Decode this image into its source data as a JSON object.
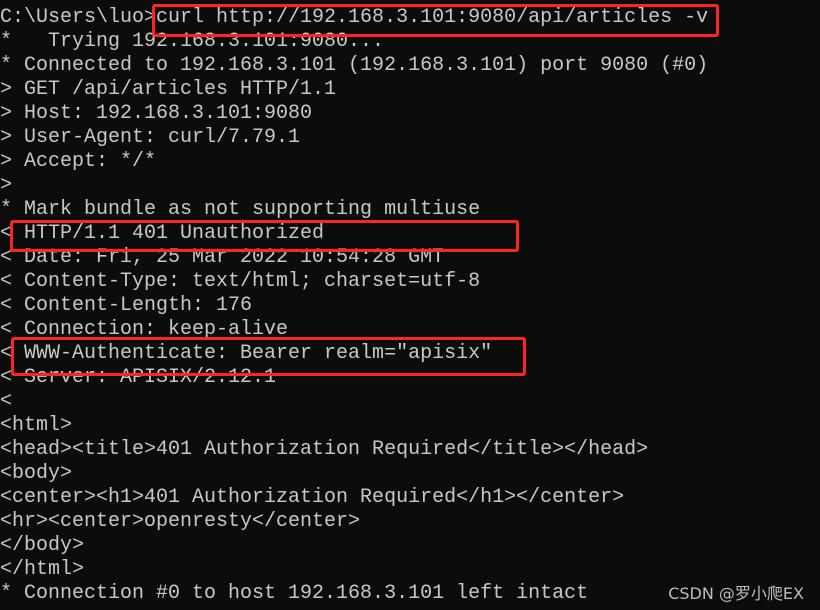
{
  "terminal": {
    "lines": [
      "C:\\Users\\luo>curl http://192.168.3.101:9080/api/articles -v",
      "*   Trying 192.168.3.101:9080...",
      "* Connected to 192.168.3.101 (192.168.3.101) port 9080 (#0)",
      "> GET /api/articles HTTP/1.1",
      "> Host: 192.168.3.101:9080",
      "> User-Agent: curl/7.79.1",
      "> Accept: */*",
      ">",
      "* Mark bundle as not supporting multiuse",
      "< HTTP/1.1 401 Unauthorized",
      "< Date: Fri, 25 Mar 2022 10:54:28 GMT",
      "< Content-Type: text/html; charset=utf-8",
      "< Content-Length: 176",
      "< Connection: keep-alive",
      "< WWW-Authenticate: Bearer realm=\"apisix\"",
      "< Server: APISIX/2.12.1",
      "<",
      "<html>",
      "<head><title>401 Authorization Required</title></head>",
      "<body>",
      "<center><h1>401 Authorization Required</h1></center>",
      "<hr><center>openresty</center>",
      "</body>",
      "</html>",
      "* Connection #0 to host 192.168.3.101 left intact"
    ]
  },
  "highlight_color": "#ff2424",
  "watermark": "CSDN @罗小爬EX"
}
